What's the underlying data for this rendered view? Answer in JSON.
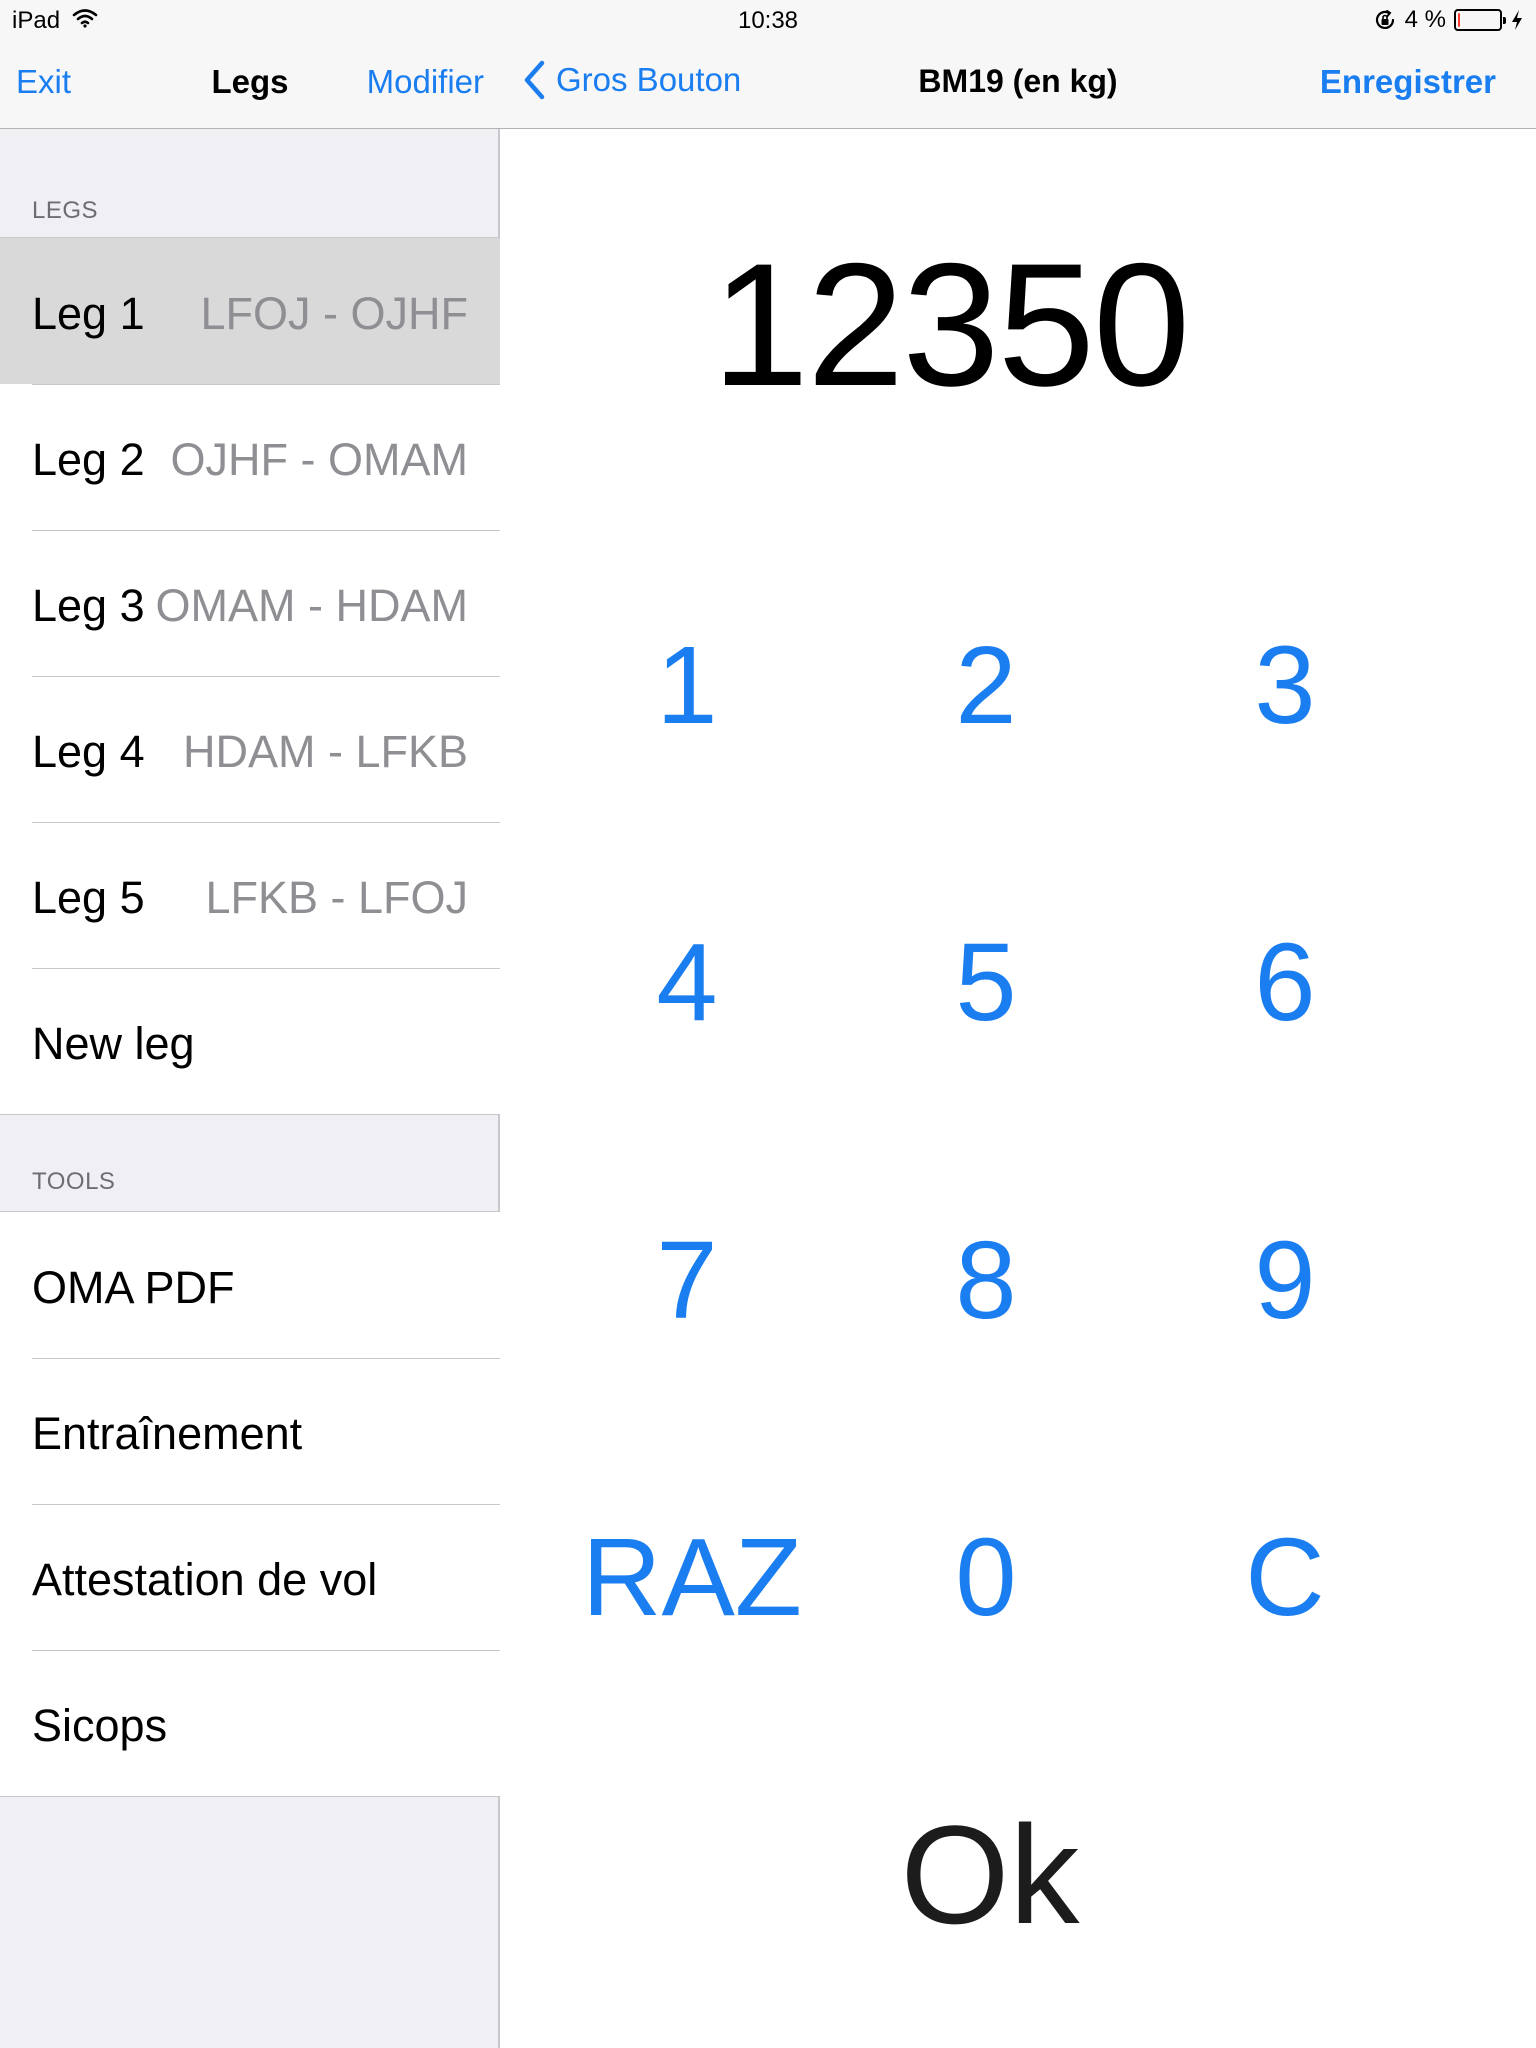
{
  "status_bar": {
    "device": "iPad",
    "time": "10:38",
    "battery_text": "4 %",
    "battery_level": 0.04,
    "icons": [
      "wifi-icon",
      "rotation-lock-icon",
      "battery-icon",
      "charging-bolt-icon"
    ]
  },
  "master": {
    "nav": {
      "left_button": "Exit",
      "title": "Legs",
      "right_button": "Modifier"
    },
    "sections": [
      {
        "header": "LEGS",
        "items": [
          {
            "title": "Leg 1",
            "detail": "LFOJ - OJHF",
            "selected": true
          },
          {
            "title": "Leg 2",
            "detail": "OJHF - OMAM"
          },
          {
            "title": "Leg 3",
            "detail": "OMAM - HDAM"
          },
          {
            "title": "Leg 4",
            "detail": "HDAM - LFKB"
          },
          {
            "title": "Leg 5",
            "detail": "LFKB - LFOJ"
          },
          {
            "title": "New leg",
            "detail": ""
          }
        ]
      },
      {
        "header": "TOOLS",
        "items": [
          {
            "title": "OMA PDF"
          },
          {
            "title": "Entraînement"
          },
          {
            "title": "Attestation de vol"
          },
          {
            "title": "Sicops"
          }
        ]
      }
    ]
  },
  "detail": {
    "nav": {
      "back_label": "Gros Bouton",
      "title": "BM19 (en kg)",
      "save_label": "Enregistrer"
    },
    "display_value": "12350",
    "keypad": {
      "k1": "1",
      "k2": "2",
      "k3": "3",
      "k4": "4",
      "k5": "5",
      "k6": "6",
      "k7": "7",
      "k8": "8",
      "k9": "9",
      "raz": "RAZ",
      "k0": "0",
      "clear": "C"
    },
    "ok_label": "Ok"
  },
  "colors": {
    "accent": "#1a7ef0",
    "selected_row": "#d9d9d9",
    "detail_text": "#8e8e93",
    "grouped_bg": "#efeff4",
    "battery_low": "#ff3b30"
  }
}
